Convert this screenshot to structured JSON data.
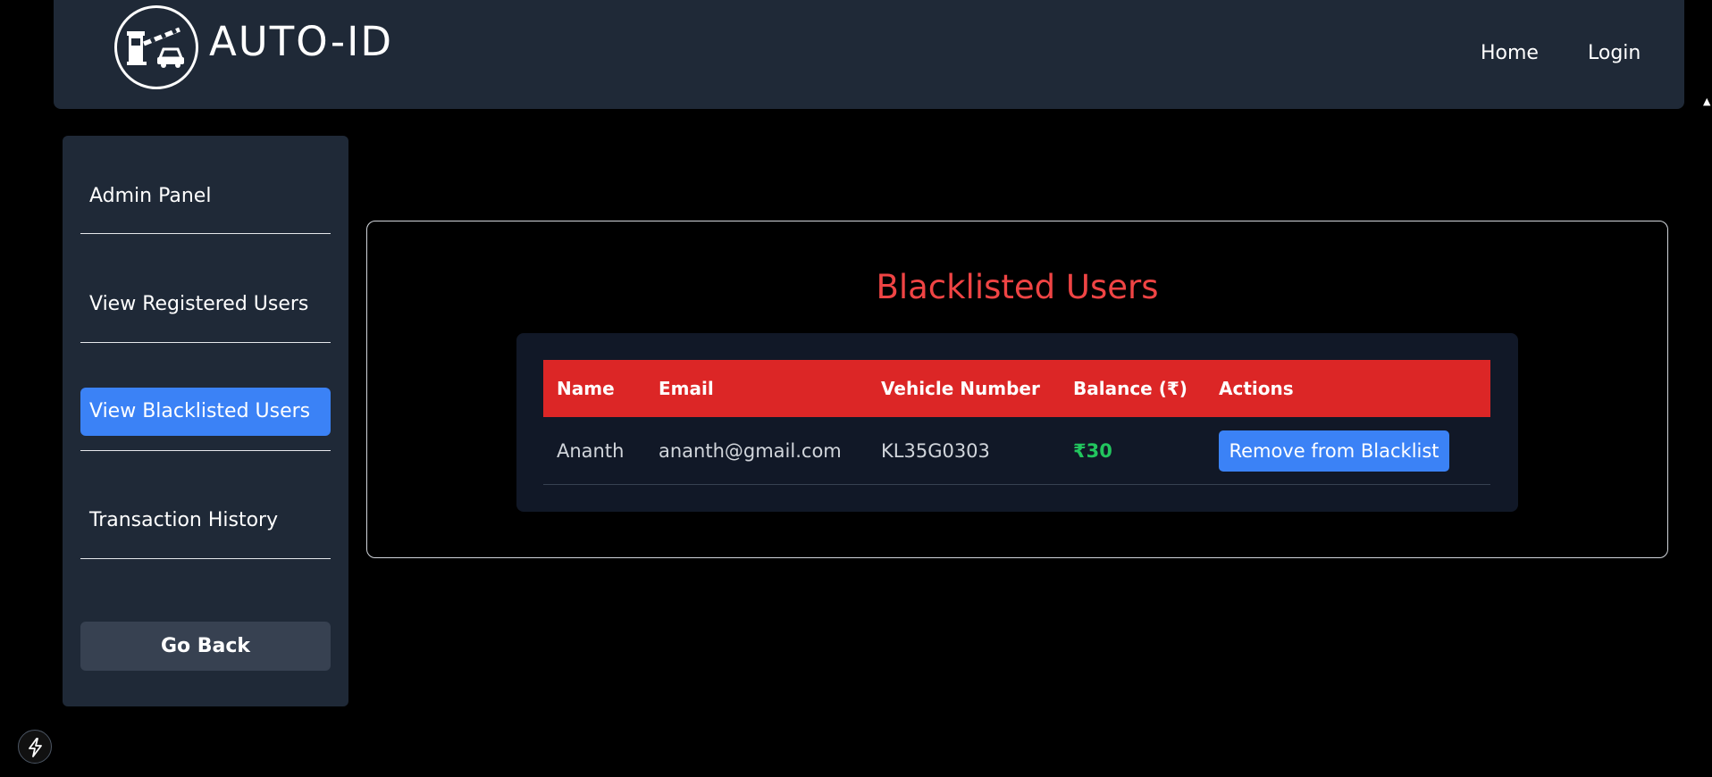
{
  "header": {
    "brand": "AUTO-ID",
    "logo_icon": "toll-gate-car-icon",
    "nav": {
      "home": "Home",
      "login": "Login"
    }
  },
  "sidebar": {
    "items": [
      {
        "label": "Admin Panel",
        "active": false
      },
      {
        "label": "View Registered Users",
        "active": false
      },
      {
        "label": "View Blacklisted Users",
        "active": true
      },
      {
        "label": "Transaction History",
        "active": false
      }
    ],
    "go_back": "Go Back"
  },
  "main": {
    "title": "Blacklisted Users",
    "table": {
      "headers": [
        "Name",
        "Email",
        "Vehicle Number",
        "Balance (₹)",
        "Actions"
      ],
      "rows": [
        {
          "name": "Ananth",
          "email": "ananth@gmail.com",
          "vehicle": "KL35G0303",
          "balance": "₹30",
          "action_label": "Remove from Blacklist"
        }
      ]
    }
  },
  "colors": {
    "accent": "#3b82f6",
    "danger": "#dc2626",
    "title": "#ef4444",
    "positive": "#22c55e",
    "panel": "#1f2937"
  }
}
